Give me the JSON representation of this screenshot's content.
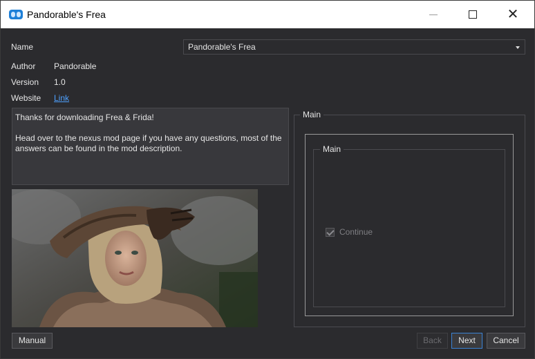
{
  "window": {
    "title": "Pandorable's Frea"
  },
  "info": {
    "name_label": "Name",
    "name_value": "Pandorable's Frea",
    "author_label": "Author",
    "author_value": "Pandorable",
    "version_label": "Version",
    "version_value": "1.0",
    "website_label": "Website",
    "website_link": "Link"
  },
  "description": {
    "line1": "Thanks for downloading Frea & Frida!",
    "line2": "Head over to the nexus mod page if you have any questions, most of the answers can be found in the mod description."
  },
  "options": {
    "outer_group_title": "Main",
    "inner_group_title": "Main",
    "checkbox_label": "Continue",
    "checkbox_checked": true,
    "checkbox_disabled": true
  },
  "buttons": {
    "manual": "Manual",
    "back": "Back",
    "next": "Next",
    "cancel": "Cancel"
  },
  "colors": {
    "accent": "#3b83d6",
    "link": "#4ea1ff",
    "background": "#2b2b2e"
  }
}
